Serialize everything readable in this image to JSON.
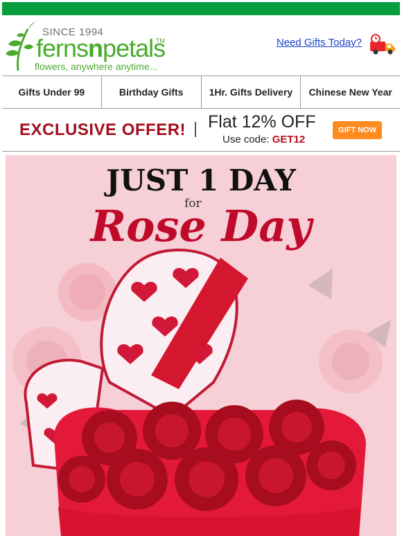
{
  "header": {
    "logo": {
      "since": "SINCE 1994",
      "name_part1": "ferns",
      "name_part2": "n",
      "name_part3": "petals",
      "tm": "TM",
      "tagline": "flowers, anywhere anytime..."
    },
    "need_gifts_link": "Need Gifts Today?"
  },
  "nav": {
    "items": [
      {
        "label": "Gifts Under 99"
      },
      {
        "label": "Birthday Gifts"
      },
      {
        "label": "1Hr. Gifts Delivery"
      },
      {
        "label": "Chinese New Year"
      }
    ]
  },
  "offer": {
    "headline": "EXCLUSIVE OFFER!",
    "flat": "Flat 12% OFF",
    "code_prefix": "Use code:",
    "code": "GET12",
    "button": "GIFT NOW"
  },
  "banner": {
    "line1": "JUST 1 DAY",
    "line2": "for",
    "line3": "Rose Day"
  },
  "colors": {
    "brand_green": "#0a9d3d",
    "offer_red": "#a30d1d",
    "button_orange": "#ff8a1d",
    "banner_pink": "#f7cfd7",
    "rose_red": "#c00a2a"
  },
  "icons": [
    "fern-logo-icon",
    "delivery-truck-clock-icon"
  ]
}
